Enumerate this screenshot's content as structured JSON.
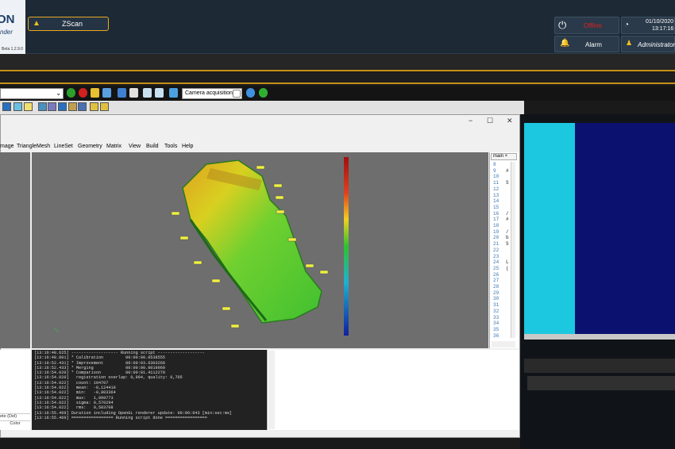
{
  "header": {
    "logo_big": "ON",
    "logo_sub": "nder",
    "version": "Beta 1.2.9.0",
    "tab_label": "ZScan",
    "status": "Offline",
    "alarm": "Alarm",
    "date": "01/10/2020",
    "time": "13:17:16",
    "user": "Administrator"
  },
  "toolbar": {
    "camera_combo": "Camera acquisition"
  },
  "window": {
    "minimize": "−",
    "maximize": "☐",
    "close": "✕"
  },
  "menu": [
    "mage",
    "TriangleMesh",
    "LineSet",
    "Geometry",
    "Matrix",
    "View",
    "Build",
    "Tools",
    "Help"
  ],
  "script_tab": "main",
  "line_numbers": [
    "8",
    "9",
    "10",
    "11",
    "12",
    "13",
    "14",
    "15",
    "16",
    "17",
    "18",
    "19",
    "20",
    "21",
    "22",
    "23",
    "24",
    "25",
    "26",
    "27",
    "28",
    "29",
    "30",
    "31",
    "32",
    "33",
    "34",
    "35",
    "36"
  ],
  "script_chars": [
    "#",
    "S",
    "/",
    "#",
    "/",
    "b",
    "S",
    "L",
    "("
  ],
  "left_items": [
    "ete (Del)",
    "Color"
  ],
  "console": [
    "[13:16:48.625] ------------------- Running script -------------------",
    "[13:16:48.801] * Calibration         00:00:00.0538555",
    "[13:16:52.431] * Improvement         00:00:03.6303268",
    "[13:16:52.433] * Merging             00:00:00.0019960",
    "[13:16:54.020] * Comparison          00:00:01.4112270",
    "[13:16:54.020]   registration overlap: 0,994, quality: 0,705",
    "[13:16:54.022]   count: 104707",
    "[13:16:54.022]   mean:  -0,124419",
    "[13:16:54.022]   min:   -0,803364",
    "[13:16:54.022]   max:   1,999773",
    "[13:16:54.022]   sigma: 0,570294",
    "[13:16:54.022]   rms:   0,583708",
    "[13:16:55.469] Duration including OpenGL renderer update: 00:06:843 [min:sec:ms]",
    "[13:16:55.469] ================= Running script done ================="
  ],
  "colors": {
    "accent": "#c89018",
    "offline": "#e02020",
    "cyan": "#1bc8e0",
    "navy": "#0b116e"
  }
}
